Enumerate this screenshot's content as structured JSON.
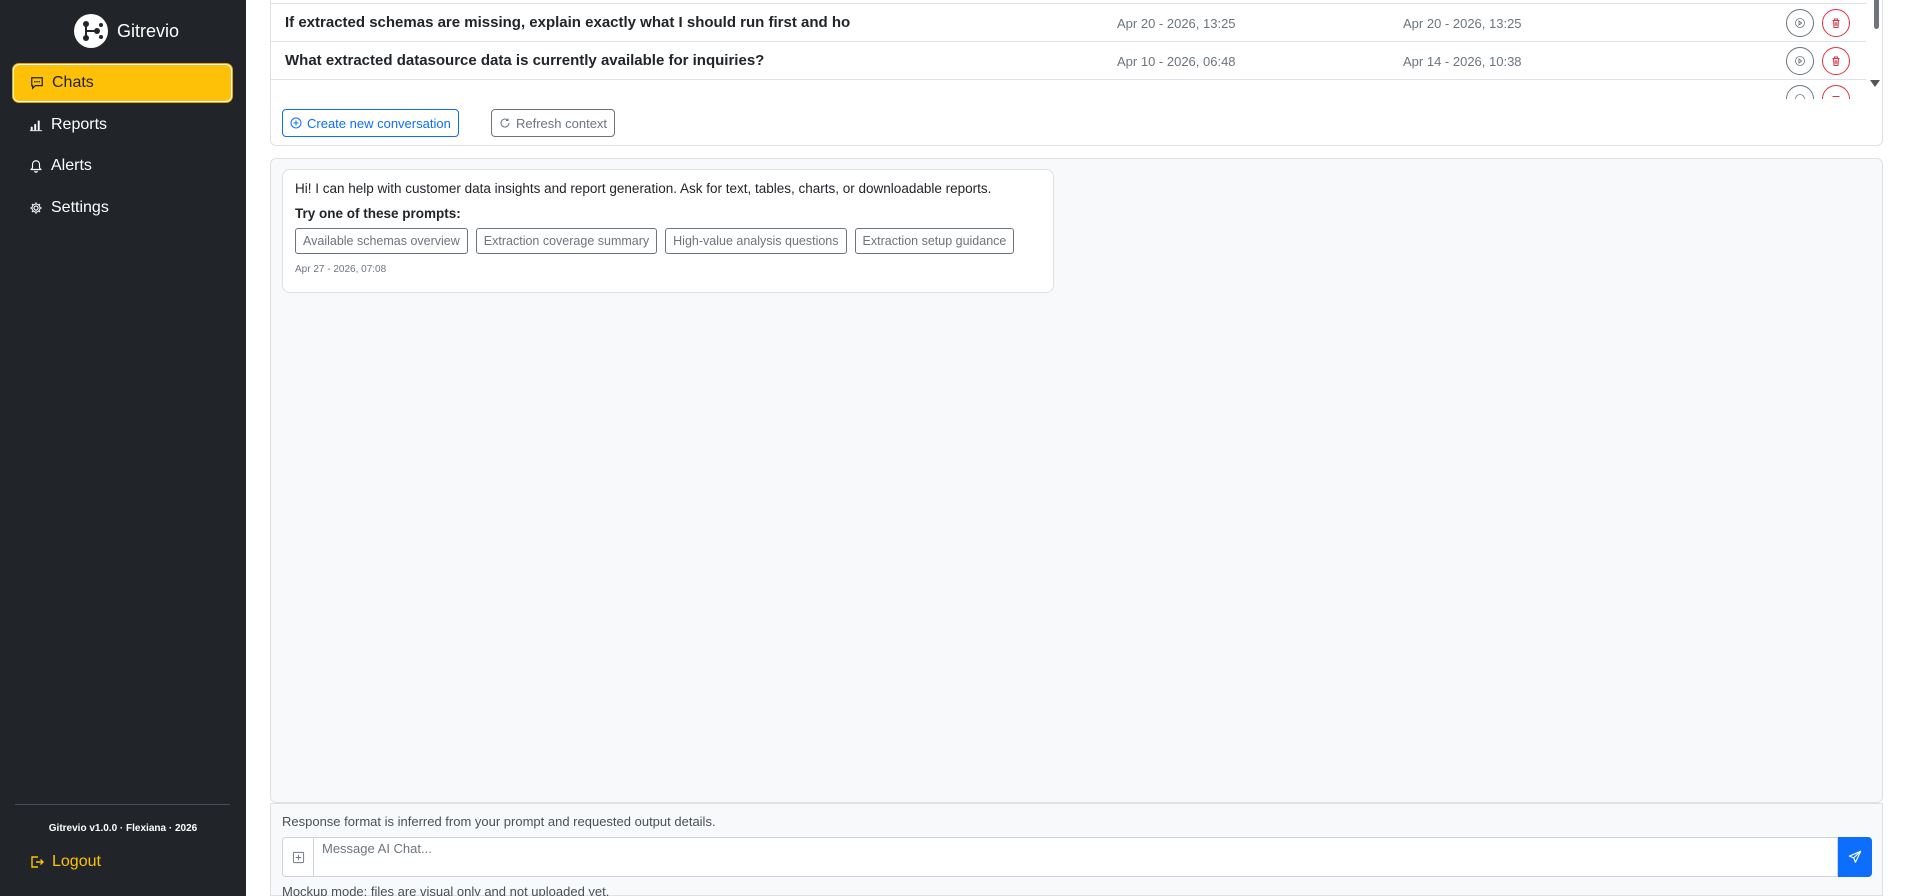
{
  "app": {
    "name": "Gitrevio",
    "version_line": "Gitrevio v1.0.0 · Flexiana · 2026"
  },
  "sidebar": {
    "items": [
      {
        "label": "Chats",
        "icon": "chat-icon",
        "active": true
      },
      {
        "label": "Reports",
        "icon": "bar-chart-icon",
        "active": false
      },
      {
        "label": "Alerts",
        "icon": "bell-icon",
        "active": false
      },
      {
        "label": "Settings",
        "icon": "gear-icon",
        "active": false
      }
    ],
    "logout_label": "Logout"
  },
  "conversations": {
    "rows": [
      {
        "title": "If extracted schemas are missing, explain exactly what I should run first and ho",
        "created": "Apr 20 - 2026, 13:25",
        "updated": "Apr 20 - 2026, 13:25"
      },
      {
        "title": "What extracted datasource data is currently available for inquiries?",
        "created": "Apr 10 - 2026, 06:48",
        "updated": "Apr 14 - 2026, 10:38"
      }
    ],
    "create_label": "Create new conversation",
    "refresh_label": "Refresh context"
  },
  "chat": {
    "message": {
      "text": "Hi! I can help with customer data insights and report generation. Ask for text, tables, charts, or downloadable reports.",
      "prompts_heading": "Try one of these prompts:",
      "prompts": [
        "Available schemas overview",
        "Extraction coverage summary",
        "High-value analysis questions",
        "Extraction setup guidance"
      ],
      "time": "Apr 27 - 2026, 07:08"
    }
  },
  "composer": {
    "format_note": "Response format is inferred from your prompt and requested output details.",
    "placeholder": "Message AI Chat...",
    "mockup_note": "Mockup mode: files are visual only and not uploaded yet."
  },
  "colors": {
    "sidebar_bg": "#212529",
    "accent": "#ffc107",
    "primary": "#0d6efd",
    "danger": "#dc3545",
    "secondary": "#6c757d"
  }
}
